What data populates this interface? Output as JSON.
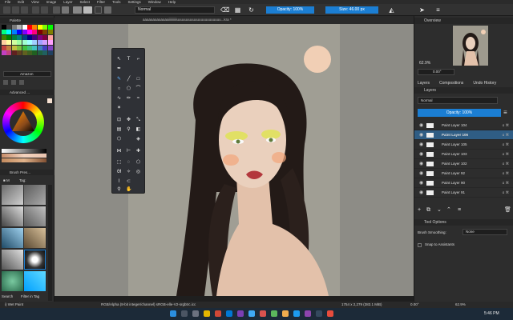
{
  "menubar": {
    "items": [
      "File",
      "Edit",
      "View",
      "Image",
      "Layer",
      "Select",
      "Filter",
      "Tools",
      "Settings",
      "Window",
      "Help"
    ]
  },
  "toolbar": {
    "blend_mode": "Normal",
    "opacity_label": "Opacity: 100%",
    "size_label": "Size: 46.00 px"
  },
  "document_tab": {
    "title": "aaaaaaaaaaaaaiiiiiiiiiiuuuuuuuuuuuuuuuuuuuuuu...kra *"
  },
  "left_panel": {
    "palette_title": "Palette",
    "palette_name": "Amazon",
    "advanced_color_title": "Advanced ...",
    "brush_presets_title": "Brush Pres...",
    "brush_tag_label": "Tag:",
    "search_label": "Search",
    "filter_tag_label": "Filter in Tag",
    "palette_colors": [
      "#000000",
      "#3a3a3a",
      "#7a7a7a",
      "#b5b5b5",
      "#ffffff",
      "#ff0000",
      "#ff8000",
      "#ffff00",
      "#80ff00",
      "#00ff00",
      "#00ff80",
      "#00ffff",
      "#0080ff",
      "#0000ff",
      "#8000ff",
      "#ff00ff",
      "#ff0080",
      "#800000",
      "#804000",
      "#808000",
      "#408000",
      "#008000",
      "#008040",
      "#008080",
      "#004080",
      "#000080",
      "#400080",
      "#800080",
      "#800040",
      "#ffa0a0",
      "#ffd0a0",
      "#ffffa0",
      "#d0ffa0",
      "#a0ffa0",
      "#a0ffd0",
      "#a0ffff",
      "#a0d0ff",
      "#a0a0ff",
      "#d0a0ff",
      "#ffa0ff",
      "#c04040",
      "#c08040",
      "#c0c040",
      "#80c040",
      "#40c040",
      "#40c080",
      "#40c0c0",
      "#4080c0",
      "#4040c0",
      "#8040c0",
      "#c040c0",
      "#c04080",
      "#602020",
      "#604020",
      "#606020",
      "#406020",
      "#206020",
      "#206040",
      "#206060",
      "#204060"
    ]
  },
  "right_panel": {
    "overview_title": "Overview",
    "zoom_label": "62.9%",
    "rotation_label": "0.00°",
    "tabs": [
      "Layers",
      "Compositions",
      "Undo History"
    ],
    "layers_title": "Layers",
    "blend_mode": "Normal",
    "opacity_label": "Opacity: 100%",
    "layers": [
      {
        "name": "Paint Layer 104",
        "selected": false
      },
      {
        "name": "Paint Layer 106",
        "selected": true
      },
      {
        "name": "Paint Layer 105",
        "selected": false
      },
      {
        "name": "Paint Layer 103",
        "selected": false
      },
      {
        "name": "Paint Layer 102",
        "selected": false
      },
      {
        "name": "Paint Layer 92",
        "selected": false
      },
      {
        "name": "Paint Layer 90",
        "selected": false
      },
      {
        "name": "Paint Layer 91",
        "selected": false
      }
    ],
    "tool_options_title": "Tool Options",
    "brush_smoothing_label": "Brush Smoothing:",
    "brush_smoothing_value": "None",
    "snap_label": "Snap to Assistants"
  },
  "statusbar": {
    "brush_name": "i) Wet Paint",
    "color_info": "RGB/Alpha (8-bit integer/channel)  sRGB-elle-V2-srgbtrc.icc",
    "dimensions": "1754 x 2,279 (383.1 MiB)",
    "rotation": "0.00°",
    "zoom": "62.9%"
  },
  "taskbar": {
    "time": "5:46 PM"
  },
  "colors": {
    "accent": "#1b7ed3",
    "panel_bg": "#2d2d2d",
    "canvas_bg": "#8d8c86",
    "selected_layer": "#2f5d84",
    "hair": "#231a17",
    "skin": "#ead0bd",
    "moon": "#f1cfb5"
  },
  "icons": [
    "brush-icon",
    "eraser-icon",
    "refresh-icon",
    "mirror-icon",
    "lock-icon",
    "eye-icon",
    "search-icon",
    "windows-start-icon"
  ]
}
